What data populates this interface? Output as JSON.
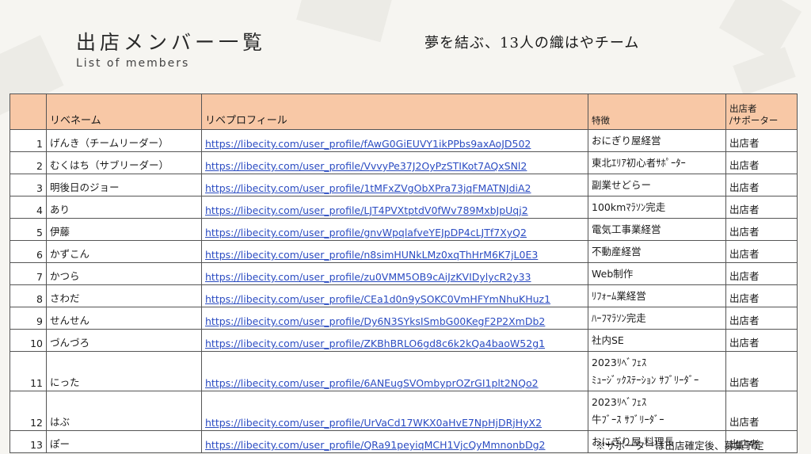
{
  "header": {
    "title": "出店メンバー一覧",
    "subtitle": "List of members",
    "tagline": "夢を結ぶ、13人の織はやチーム"
  },
  "table": {
    "headers": {
      "number": "",
      "name": "リベネーム",
      "profile": "リベプロフィール",
      "feature": "特徴",
      "role_line1": "出店者",
      "role_line2": "/サポーター"
    },
    "rows": [
      {
        "no": "1",
        "name": "げんき（チームリーダー）",
        "url": "https://libecity.com/user_profile/fAwG0GiEUVY1ikPPbs9axAoJD502",
        "feature": [
          "おにぎり屋経営"
        ],
        "role": "出店者"
      },
      {
        "no": "2",
        "name": "むくはち（サブリーダー）",
        "url": "https://libecity.com/user_profile/VvvyPe37J2OyPzSTIKot7AQxSNl2",
        "feature": [
          "東北ｴﾘｱ初心者ｻﾎﾟｰﾀｰ"
        ],
        "role": "出店者"
      },
      {
        "no": "3",
        "name": "明後日のジョー",
        "url": "https://libecity.com/user_profile/1tMFxZVgObXPra73jqFMATNJdiA2",
        "feature": [
          "副業せどらー"
        ],
        "role": "出店者"
      },
      {
        "no": "4",
        "name": "あり",
        "url": "https://libecity.com/user_profile/LJT4PVXtptdV0fWv789MxbJpUqj2",
        "feature": [
          "100kmﾏﾗｿﾝ完走"
        ],
        "role": "出店者"
      },
      {
        "no": "5",
        "name": "伊藤",
        "url": "https://libecity.com/user_profile/gnvWpqlafveYEJpDP4cLJTf7XyQ2",
        "feature": [
          "電気工事業経営"
        ],
        "role": "出店者"
      },
      {
        "no": "6",
        "name": "かずこん",
        "url": "https://libecity.com/user_profile/n8simHUNkLMz0xqThHrM6K7jL0E3",
        "feature": [
          "不動産経営"
        ],
        "role": "出店者"
      },
      {
        "no": "7",
        "name": "かつら",
        "url": "https://libecity.com/user_profile/zu0VMM5OB9cAiJzKVIDylycR2y33",
        "feature": [
          "Web制作"
        ],
        "role": "出店者"
      },
      {
        "no": "8",
        "name": "さわだ",
        "url": "https://libecity.com/user_profile/CEa1d0n9ySOKC0VmHFYmNhuKHuz1",
        "feature": [
          "ﾘﾌｫｰﾑ業経営"
        ],
        "role": "出店者"
      },
      {
        "no": "9",
        "name": "せんせん",
        "url": "https://libecity.com/user_profile/Dy6N3SYksISmbG00KegF2P2XmDb2",
        "feature": [
          "ﾊｰﾌﾏﾗｿﾝ完走"
        ],
        "role": "出店者"
      },
      {
        "no": "10",
        "name": "づんづろ",
        "url": "https://libecity.com/user_profile/ZKBhBRLO6gd8c6k2kQa4baoW52g1",
        "feature": [
          "社内SE"
        ],
        "role": "出店者"
      },
      {
        "no": "11",
        "name": "にった",
        "url": "https://libecity.com/user_profile/6ANEugSVOmbyprOZrGI1plt2NQo2",
        "feature": [
          "2023ﾘﾍﾞﾌｪｽ",
          "ﾐｭｰｼﾞｯｸｽﾃｰｼｮﾝ ｻﾌﾞﾘｰﾀﾞｰ"
        ],
        "role": "出店者"
      },
      {
        "no": "12",
        "name": "はぶ",
        "url": "https://libecity.com/user_profile/UrVaCd17WKX0aHvE7NpHjDRjHyX2",
        "feature": [
          "2023ﾘﾍﾞﾌｪｽ",
          "牛ﾌﾞｰｽ ｻﾌﾞﾘｰﾀﾞｰ"
        ],
        "role": "出店者"
      },
      {
        "no": "13",
        "name": "ぽー",
        "url": "https://libecity.com/user_profile/QRa91peyiqMCH1VjcQyMmnonbDg2",
        "feature": [
          "おにぎり屋 料理長"
        ],
        "role": "出店者"
      }
    ]
  },
  "footnote": "※サポーターは出店確定後、募集予定"
}
